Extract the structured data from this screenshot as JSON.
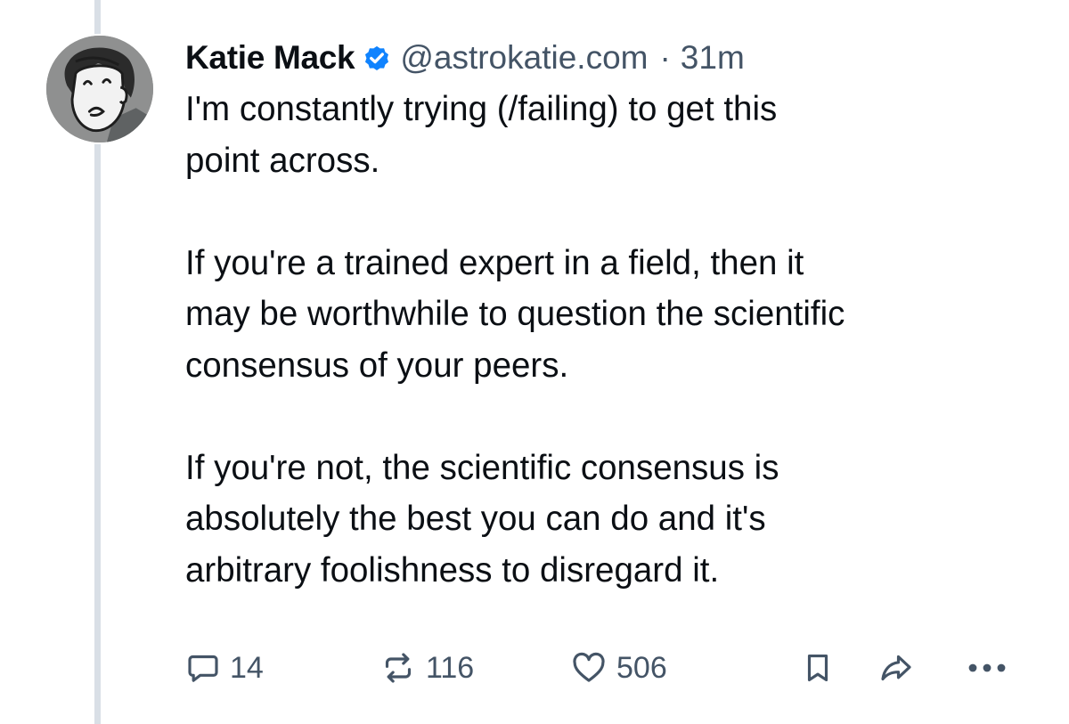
{
  "post": {
    "author": {
      "display_name": "Katie Mack",
      "handle": "@astrokatie.com",
      "verified_icon": "verified-badge-icon",
      "avatar_icon": "avatar-cartoon-portrait"
    },
    "separator": "·",
    "time": "31m",
    "text_lines": [
      [
        "I'm constantly trying (/failing) to get this",
        "point across."
      ],
      [
        "If you're a trained expert in a field, then it",
        "may be worthwhile to question the scientific",
        "consensus of your peers."
      ],
      [
        "If you're not, the scientific consensus is",
        "absolutely the best you can do and it's",
        "arbitrary foolishness to disregard it."
      ]
    ],
    "actions": {
      "reply": {
        "icon": "reply-bubble-icon",
        "count": "14"
      },
      "repost": {
        "icon": "repost-icon",
        "count": "116"
      },
      "like": {
        "icon": "heart-icon",
        "count": "506"
      },
      "bookmark": {
        "icon": "bookmark-icon"
      },
      "share": {
        "icon": "share-arrow-icon"
      },
      "more": {
        "icon": "more-dots-icon"
      }
    }
  },
  "colors": {
    "text": "#0b0f14",
    "muted": "#445466",
    "verified": "#1083fe",
    "thread_line": "#d9dfe6",
    "avatar_bg": "#8f9090"
  }
}
